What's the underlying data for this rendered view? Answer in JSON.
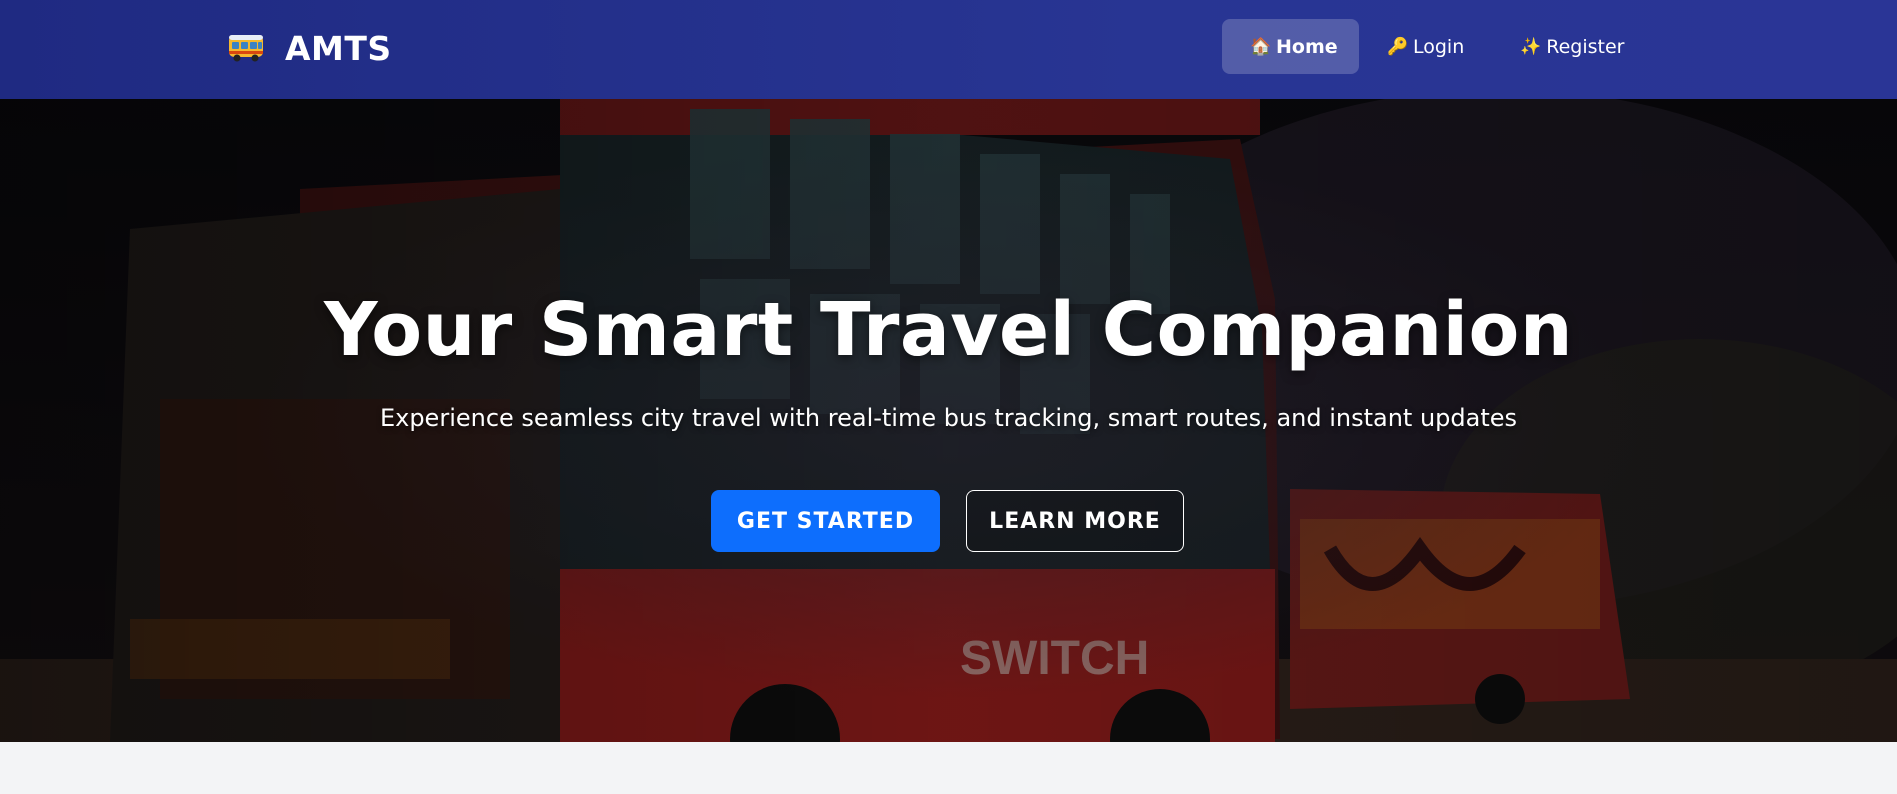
{
  "brand": {
    "name": "AMTS",
    "icon": "bus-icon"
  },
  "nav": {
    "items": [
      {
        "emoji": "🏠",
        "label": "Home",
        "icon": "house-icon",
        "active": true
      },
      {
        "emoji": "🔑",
        "label": "Login",
        "icon": "key-icon",
        "active": false
      },
      {
        "emoji": "✨",
        "label": "Register",
        "icon": "sparkles-icon",
        "active": false
      }
    ]
  },
  "hero": {
    "title": "Your Smart Travel Companion",
    "subtitle": "Experience seamless city travel with real-time bus tracking, smart routes, and instant updates",
    "primary_button": "GET STARTED",
    "secondary_button": "LEARN MORE",
    "background": "night photo of red city buses"
  },
  "colors": {
    "navbar": "#283593",
    "primary": "#0d6efd",
    "below": "#f3f4f6"
  }
}
